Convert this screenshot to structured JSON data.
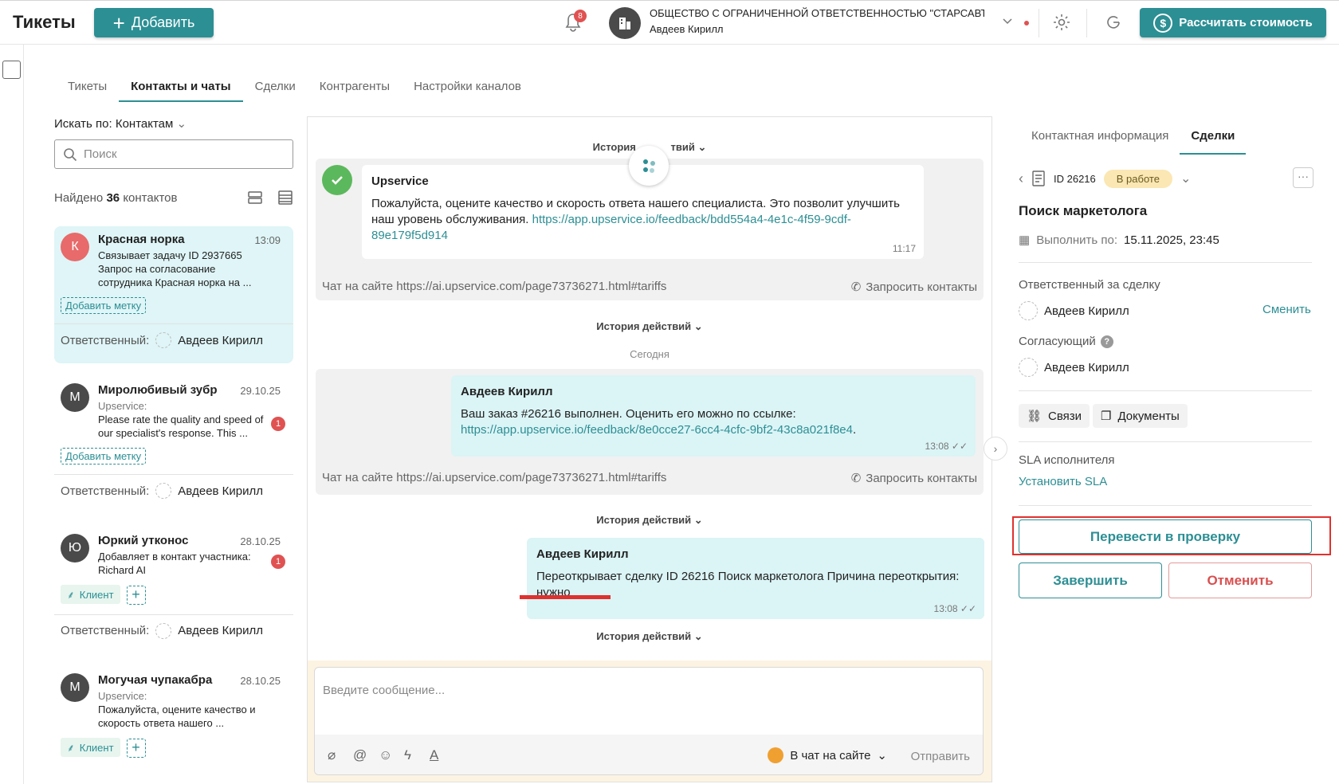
{
  "header": {
    "title": "Тикеты",
    "add_label": "Добавить",
    "notif_count": "8",
    "org_name": "ОБЩЕСТВО С ОГРАНИЧЕННОЙ ОТВЕТСТВЕННОСТЬЮ \"СТАРСАВТО...",
    "org_user": "Авдеев Кирилл",
    "calc_label": "Рассчитать стоимость"
  },
  "tabs": [
    "Тикеты",
    "Контакты и чаты",
    "Сделки",
    "Контрагенты",
    "Настройки каналов"
  ],
  "contacts_panel": {
    "search_by": "Искать по: Контактам",
    "search_placeholder": "Поиск",
    "found_prefix": "Найдено",
    "found_count": "36",
    "found_suffix": "контактов"
  },
  "contacts": [
    {
      "initial": "К",
      "name": "Красная норка",
      "time": "13:09",
      "src": "",
      "text": "Связывает задачу ID 2937665 Запрос на согласование сотрудника Красная норка на ...",
      "tag": "Добавить метку",
      "resp_label": "Ответственный:",
      "resp": "Авдеев Кирилл"
    },
    {
      "initial": "М",
      "name": "Миролюбивый зубр",
      "time": "29.10.25",
      "src": "Upservice:",
      "text": "Please rate the quality and speed of our specialist's response. This ...",
      "unread": "1",
      "tag": "Добавить метку",
      "resp_label": "Ответственный:",
      "resp": "Авдеев Кирилл"
    },
    {
      "initial": "Ю",
      "name": "Юркий утконос",
      "time": "28.10.25",
      "src": "",
      "text": "Добавляет в контакт участника: Richard AI",
      "unread": "1",
      "client": "Клиент",
      "resp_label": "Ответственный:",
      "resp": "Авдеев Кирилл"
    },
    {
      "initial": "М",
      "name": "Могучая чупакабра",
      "time": "28.10.25",
      "src": "Upservice:",
      "text": "Пожалуйста, оцените качество и скорость ответа нашего ...",
      "client": "Клиент"
    }
  ],
  "chat": {
    "history_label": "История действий",
    "history_partial": "История",
    "history_partial_end": "твий",
    "msg1": {
      "author": "Upservice",
      "text": "Пожалуйста, оцените качество и скорость ответа нашего специалиста. Это позволит улучшить наш уровень обслуживания.",
      "link": "https://app.upservice.io/feedback/bdd554a4-4e1c-4f59-9cdf-89e179f5d914",
      "time": "11:17"
    },
    "chat_source": "Чат на сайте https://ai.upservice.com/page73736271.html#tariffs",
    "request_contacts": "Запросить контакты",
    "today": "Сегодня",
    "msg2": {
      "author": "Авдеев Кирилл",
      "text": "Ваш заказ #26216 выполнен. Оценить его можно по ссылке:",
      "link": "https://app.upservice.io/feedback/8e0cce27-6cc4-4cfc-9bf2-43c8a021f8e4",
      "time": "13:08"
    },
    "msg3": {
      "author": "Авдеев Кирилл",
      "text": "Переоткрывает сделку ID 26216 Поиск маркетолога Причина переоткрытия:",
      "text2": "нужно",
      "time": "13:08"
    },
    "composer_placeholder": "Введите сообщение...",
    "channel": "В чат на сайте",
    "send": "Отправить"
  },
  "right": {
    "tabs": [
      "Контактная информация",
      "Сделки"
    ],
    "deal_id": "ID 26216",
    "status": "В работе",
    "deal_title": "Поиск маркетолога",
    "due_label": "Выполнить по:",
    "due_value": "15.11.2025, 23:45",
    "responsible_label": "Ответственный за сделку",
    "responsible": "Авдеев Кирилл",
    "change": "Сменить",
    "approver_label": "Согласующий",
    "approver": "Авдеев Кирилл",
    "links": "Связи",
    "docs": "Документы",
    "sla_label": "SLA исполнителя",
    "sla_link": "Установить SLA",
    "review_btn": "Перевести в проверку",
    "finish_btn": "Завершить",
    "cancel_btn": "Отменить"
  },
  "colors": {
    "accent": "#2c8f94",
    "danger": "#e0312e",
    "selected_card": "#dff5f7"
  }
}
